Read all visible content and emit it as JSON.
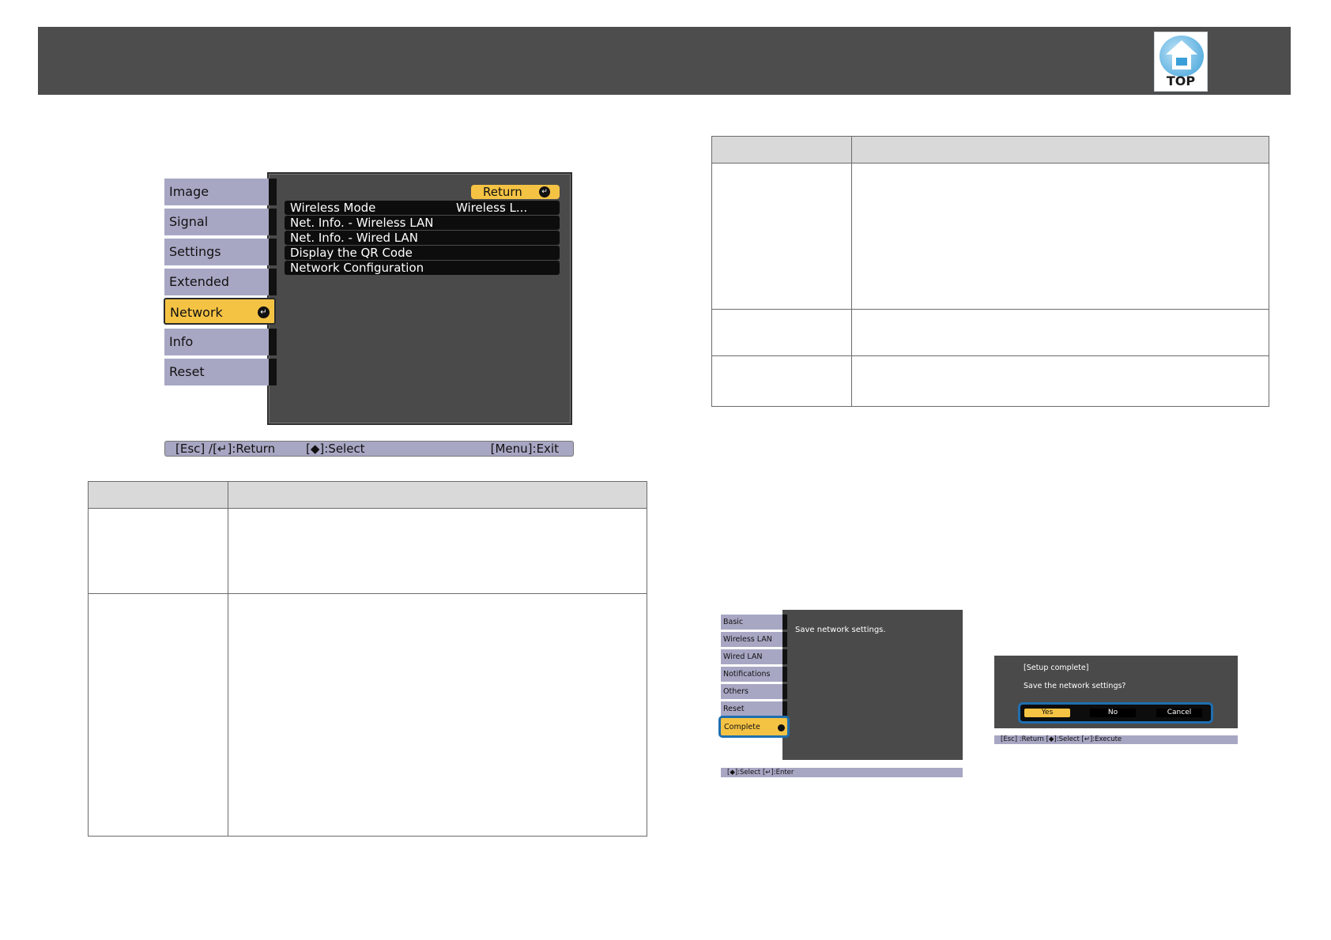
{
  "header": {
    "logo_label": "TOP"
  },
  "osd": {
    "tabs": [
      "Image",
      "Signal",
      "Settings",
      "Extended",
      "Network",
      "Info",
      "Reset"
    ],
    "active_tab": "Network",
    "return_label": "Return",
    "items": [
      {
        "label": "Wireless Mode",
        "value": "Wireless L..."
      },
      {
        "label": "Net. Info. - Wireless LAN",
        "value": ""
      },
      {
        "label": "Net. Info. - Wired LAN",
        "value": ""
      },
      {
        "label": "Display the QR Code",
        "value": ""
      },
      {
        "label": "Network Configuration",
        "value": ""
      }
    ],
    "footer": {
      "return": "[Esc] /[↵]:Return",
      "select": "[◆]:Select",
      "exit": "[Menu]:Exit"
    }
  },
  "complete_screen": {
    "tabs": [
      "Basic",
      "Wireless LAN",
      "Wired LAN",
      "Notifications",
      "Others",
      "Reset",
      "Complete"
    ],
    "active_tab": "Complete",
    "message": "Save network settings.",
    "footer": "[◆]:Select   [↵]:Enter"
  },
  "confirm_dialog": {
    "line1": "[Setup complete]",
    "line2": "Save the network settings?",
    "yes": "Yes",
    "no": "No",
    "cancel": "Cancel",
    "footer": "[Esc] :Return   [◆]:Select   [↵]:Execute"
  }
}
